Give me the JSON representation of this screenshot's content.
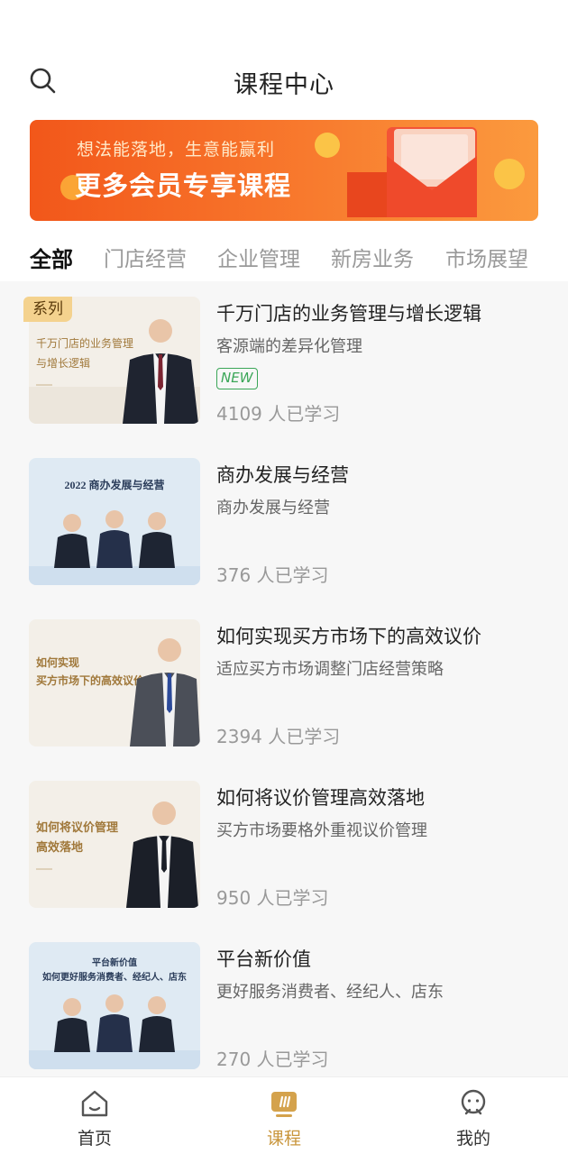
{
  "header": {
    "title": "课程中心",
    "search_icon": "search-icon"
  },
  "banner": {
    "subtitle": "想法能落地，生意能赢利",
    "headline": "更多会员专享课程",
    "coin_symbol": "¥",
    "colors": {
      "start": "#f2571a",
      "end": "#fb9a3e"
    }
  },
  "tabs": [
    {
      "label": "全部",
      "active": true
    },
    {
      "label": "门店经营",
      "active": false
    },
    {
      "label": "企业管理",
      "active": false
    },
    {
      "label": "新房业务",
      "active": false
    },
    {
      "label": "市场展望",
      "active": false
    }
  ],
  "courses": [
    {
      "badge": "系列",
      "title": "千万门店的业务管理与增长逻辑",
      "subtitle": "客源端的差异化管理",
      "tag": "NEW",
      "count": "4109 人已学习",
      "thumb": {
        "lines": [
          "千万门店的业务管理",
          "与增长逻辑"
        ]
      }
    },
    {
      "title": "商办发展与经营",
      "subtitle": "商办发展与经营",
      "count": "376 人已学习",
      "thumb": {
        "lines": [
          "2022 商办发展与经营"
        ]
      }
    },
    {
      "title": "如何实现买方市场下的高效议价",
      "subtitle": "适应买方市场调整门店经营策略",
      "count": "2394 人已学习",
      "thumb": {
        "lines": [
          "如何实现",
          "买方市场下的高效议价"
        ]
      }
    },
    {
      "title": "如何将议价管理高效落地",
      "subtitle": "买方市场要格外重视议价管理",
      "count": "950 人已学习",
      "thumb": {
        "lines": [
          "如何将议价管理",
          "高效落地"
        ]
      }
    },
    {
      "title": "平台新价值",
      "subtitle": "更好服务消费者、经纪人、店东",
      "count": "270 人已学习",
      "thumb": {
        "lines": [
          "平台新价值",
          "如何更好服务消费者、经纪人、店东"
        ]
      }
    }
  ],
  "tabbar": [
    {
      "label": "首页",
      "icon": "home-icon",
      "active": false
    },
    {
      "label": "课程",
      "icon": "course-icon",
      "active": true
    },
    {
      "label": "我的",
      "icon": "profile-icon",
      "active": false
    }
  ],
  "colors": {
    "accent": "#c9963c",
    "new_tag": "#3aa657",
    "badge_bg": "#f4d28e"
  }
}
